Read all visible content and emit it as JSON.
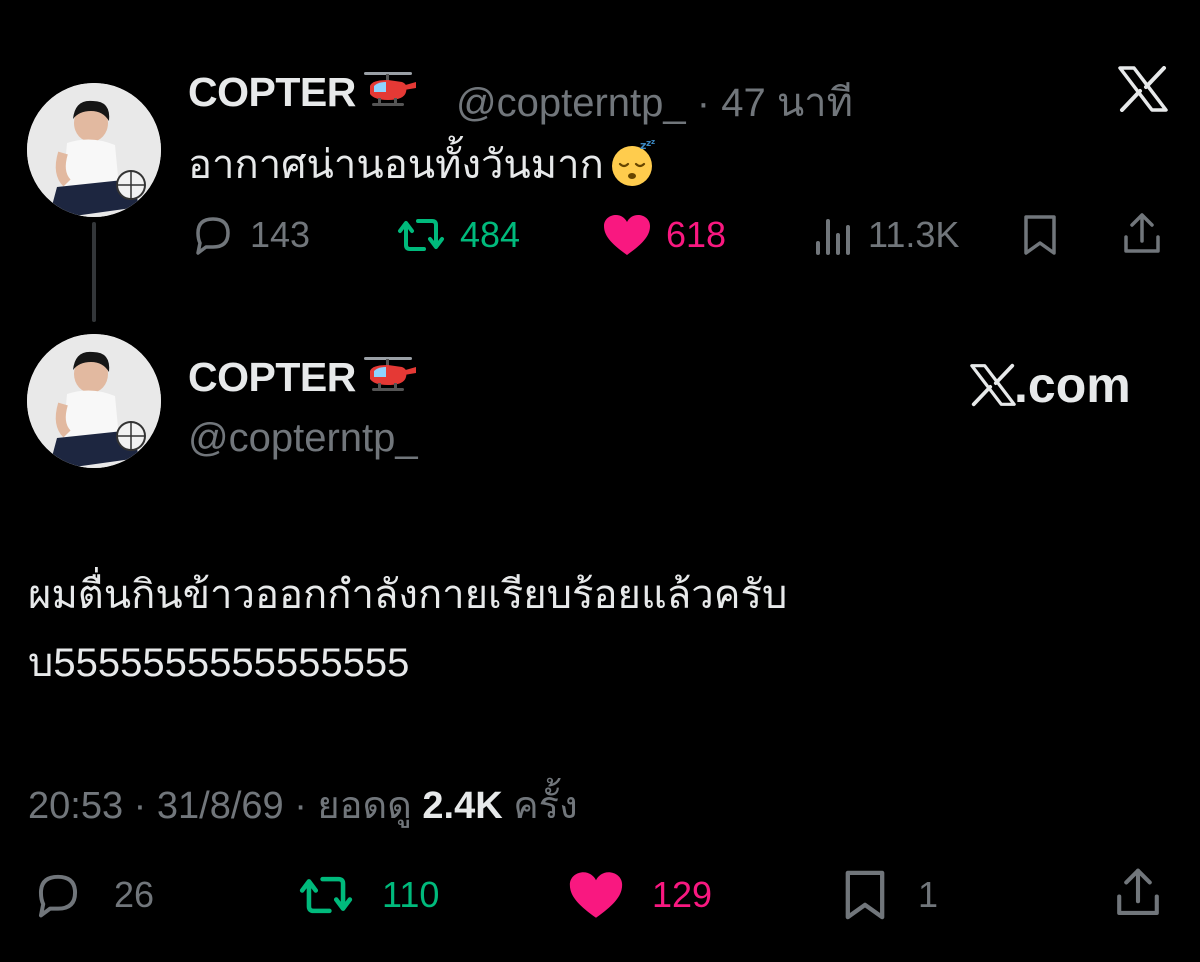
{
  "parent_tweet": {
    "display_name": "COPTER",
    "handle": "@copterntp_",
    "time_sep": "·",
    "time": "47 นาที",
    "text": "อากาศน่านอนทั้งวันมาก",
    "emoji": "sleeping-face",
    "replies": "143",
    "reposts": "484",
    "likes": "618",
    "views": "11.3K"
  },
  "main_tweet": {
    "display_name": "COPTER",
    "handle": "@copterntp_",
    "brand": "X.com",
    "text_line1": "ผมตื่นกินข้าวออกกำลังกายเรียบร้อยแล้วครับ",
    "text_line2": "บ5555555555555555",
    "timestamp": "20:53 · 31/8/69 · ยอดดู",
    "views": "2.4K",
    "views_suffix": "ครั้ง",
    "replies": "26",
    "reposts": "110",
    "likes": "129",
    "bookmarks": "1"
  },
  "colors": {
    "background": "#000000",
    "text": "#e7e9ea",
    "muted": "#71767b",
    "repost": "#00ba7c",
    "like": "#f91880"
  },
  "icons": [
    "x-logo-icon",
    "helicopter-icon",
    "reply-icon",
    "repost-icon",
    "heart-icon",
    "views-icon",
    "bookmark-icon",
    "share-icon"
  ]
}
